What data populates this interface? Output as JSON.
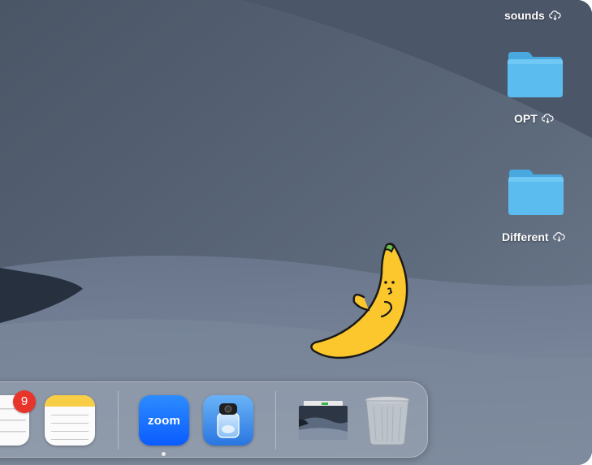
{
  "desktop": {
    "items": [
      {
        "label": "sounds",
        "type": "folder",
        "cloud": true
      },
      {
        "label": "OPT",
        "type": "folder",
        "cloud": true
      },
      {
        "label": "Different",
        "type": "folder",
        "cloud": true
      }
    ]
  },
  "dock": {
    "apps": [
      {
        "name": "Reminders",
        "icon": "reminders-icon",
        "badge": "9"
      },
      {
        "name": "Notes",
        "icon": "notes-icon"
      },
      {
        "name": "Zoom",
        "icon": "zoom-icon",
        "label": "zoom",
        "running": true
      },
      {
        "name": "Preview",
        "icon": "preview-icon"
      },
      {
        "name": "Downloads",
        "icon": "downloads-stack-icon"
      },
      {
        "name": "Trash",
        "icon": "trash-icon"
      }
    ]
  },
  "colors": {
    "folder_blue": "#5bbcf0",
    "badge_red": "#e8352c",
    "zoom_blue": "#0b5cff",
    "notes_yellow": "#f7ce46",
    "banana_yellow": "#fcc72c"
  }
}
